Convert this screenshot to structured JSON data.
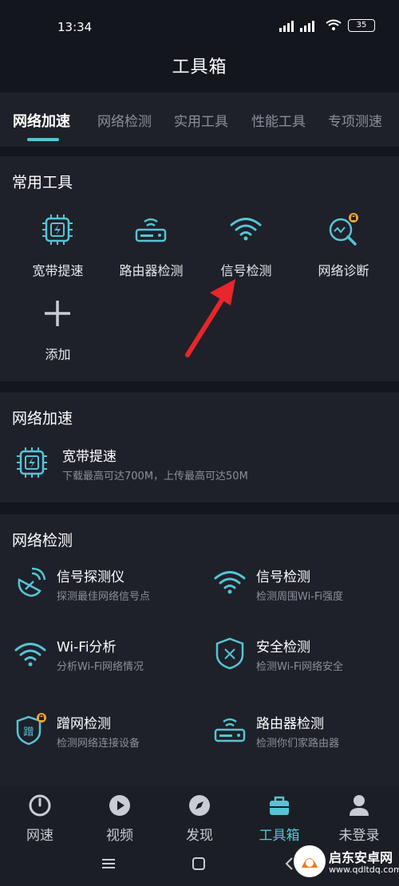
{
  "status": {
    "time": "13:34",
    "battery": "35"
  },
  "app": {
    "title": "工具箱"
  },
  "tabs": [
    "网络加速",
    "网络检测",
    "实用工具",
    "性能工具",
    "专项测速"
  ],
  "common_tools": {
    "title": "常用工具",
    "items": [
      {
        "label": "宽带提速",
        "icon": "chip-bolt-icon"
      },
      {
        "label": "路由器检测",
        "icon": "router-icon"
      },
      {
        "label": "信号检测",
        "icon": "wifi-icon"
      },
      {
        "label": "网络诊断",
        "icon": "diagnose-search-icon"
      },
      {
        "label": "添加",
        "icon": "plus-icon"
      }
    ]
  },
  "acceleration": {
    "title": "网络加速",
    "item": {
      "title": "宽带提速",
      "desc": "下载最高可达700M，上传最高可达50M"
    }
  },
  "detection": {
    "title": "网络检测",
    "items": [
      {
        "title": "信号探测仪",
        "desc": "探测最佳网络信号点"
      },
      {
        "title": "信号检测",
        "desc": "检测周围Wi-Fi强度"
      },
      {
        "title": "Wi-Fi分析",
        "desc": "分析Wi-Fi网络情况"
      },
      {
        "title": "安全检测",
        "desc": "检测Wi-Fi网络安全"
      },
      {
        "title": "蹭网检测",
        "desc": "检测网络连接设备"
      },
      {
        "title": "路由器检测",
        "desc": "检测你们家路由器"
      }
    ]
  },
  "bottom_nav": [
    "网速",
    "视频",
    "发现",
    "工具箱",
    "未登录"
  ],
  "watermark": {
    "brand": "启东安卓网",
    "url": "www.qdltdq.com"
  },
  "colors": {
    "accent": "#56c4d6",
    "background": "#13161d",
    "card": "#1e2129",
    "arrow": "#e8262b"
  }
}
